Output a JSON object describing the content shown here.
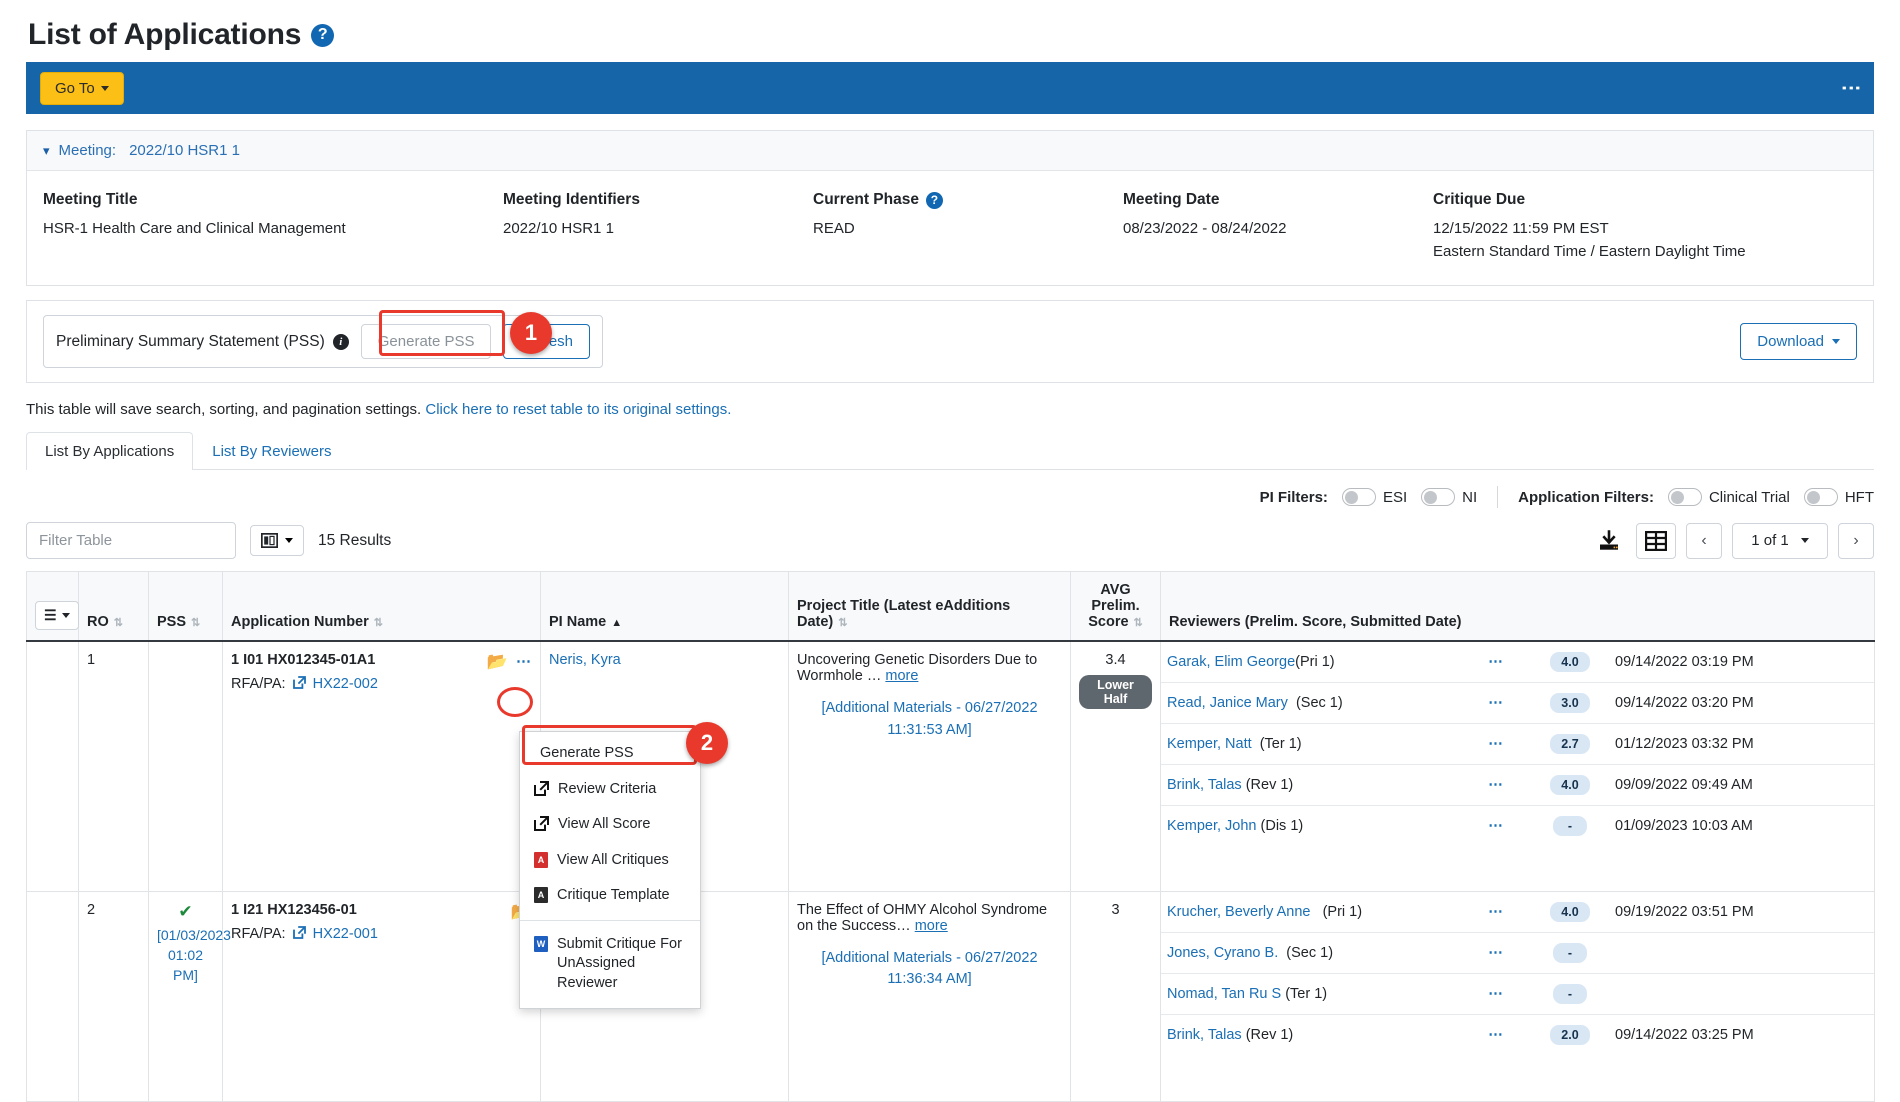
{
  "page": {
    "title": "List of Applications",
    "help_icon": "?"
  },
  "blue_bar": {
    "goto_label": "Go To",
    "kebab_icon": "⋮"
  },
  "meeting_panel": {
    "header_label": "Meeting:",
    "header_value": "2022/10 HSR1 1",
    "fields": [
      {
        "label": "Meeting Title",
        "value": "HSR-1 Health Care and Clinical Management",
        "help": false
      },
      {
        "label": "Meeting Identifiers",
        "value": "2022/10 HSR1 1",
        "help": false
      },
      {
        "label": "Current Phase",
        "value": "READ",
        "help": true
      },
      {
        "label": "Meeting Date",
        "value": "08/23/2022 - 08/24/2022",
        "help": false
      },
      {
        "label": "Critique Due",
        "value": "12/15/2022 11:59 PM EST",
        "value2": "Eastern Standard Time / Eastern Daylight Time",
        "help": false
      }
    ]
  },
  "pss_bar": {
    "label": "Preliminary Summary Statement (PSS)",
    "info_icon": "i",
    "generate_label": "Generate PSS",
    "refresh_label": "Refresh",
    "download_label": "Download"
  },
  "annotations": [
    {
      "number": "1"
    },
    {
      "number": "2"
    }
  ],
  "reset_note": {
    "text": "This table will save search, sorting, and pagination settings.",
    "link": "Click here to reset table to its original settings."
  },
  "tabs": [
    {
      "label": "List By Applications",
      "active": true
    },
    {
      "label": "List By Reviewers",
      "active": false
    }
  ],
  "filters": {
    "pi_label": "PI Filters:",
    "pi_items": [
      "ESI",
      "NI"
    ],
    "app_label": "Application Filters:",
    "app_items": [
      "Clinical Trial",
      "HFT"
    ]
  },
  "toolbar": {
    "filter_placeholder": "Filter Table",
    "results": "15 Results",
    "page_value": "1 of 1",
    "prev_icon": "‹",
    "next_icon": "›",
    "download_icon": "download-icon",
    "grid_icon": "grid-icon"
  },
  "table": {
    "columns": [
      {
        "key": "menu",
        "label": ""
      },
      {
        "key": "ro",
        "label": "RO",
        "sortable": true
      },
      {
        "key": "pss",
        "label": "PSS",
        "sortable": true
      },
      {
        "key": "appnum",
        "label": "Application Number",
        "sortable": true
      },
      {
        "key": "pi",
        "label": "PI Name",
        "sorted": "asc"
      },
      {
        "key": "proj",
        "label": "Project Title (Latest eAdditions Date)",
        "sortable": true
      },
      {
        "key": "avg",
        "label": "AVG Prelim. Score",
        "sortable": true
      },
      {
        "key": "rev",
        "label": "Reviewers (Prelim. Score, Submitted Date)"
      }
    ],
    "rows": [
      {
        "ro": "1",
        "pss_check": false,
        "pss_date": "",
        "app_number": "1 I01 HX012345-01A1",
        "rfa_label": "RFA/PA:",
        "rfa_value": "HX22-002",
        "pi_name": "Neris, Kyra",
        "project_title": "Uncovering Genetic Disorders Due to Wormhole …",
        "project_more": "more",
        "additional": "[Additional Materials - 06/27/2022 11:31:53 AM]",
        "avg_score": "3.4",
        "half_badge": "Lower Half",
        "reviewers": [
          {
            "name": "Garak, Elim George",
            "role": "(Pri 1)",
            "score": "4.0",
            "date": "09/14/2022 03:19 PM"
          },
          {
            "name": "Read, Janice Mary",
            "role": "(Sec 1)",
            "score": "3.0",
            "date": "09/14/2022 03:20 PM"
          },
          {
            "name": "Kemper, Natt",
            "role": "(Ter 1)",
            "score": "2.7",
            "date": "01/12/2023 03:32 PM"
          },
          {
            "name": "Brink, Talas",
            "role": "(Rev 1)",
            "score": "4.0",
            "date": "09/09/2022 09:49 AM"
          },
          {
            "name": "Kemper, John",
            "role": "(Dis 1)",
            "score": "-",
            "date": "01/09/2023 10:03 AM"
          }
        ]
      },
      {
        "ro": "2",
        "pss_check": true,
        "pss_date": "[01/03/2023 01:02 PM]",
        "app_number": "1 I21 HX123456-01",
        "rfa_label": "RFA/PA:",
        "rfa_value": "HX22-001",
        "pi_name": "",
        "project_title": "The Effect of OHMY Alcohol Syndrome on the Success…",
        "project_more": "more",
        "additional": "[Additional Materials - 06/27/2022 11:36:34 AM]",
        "avg_score": "3",
        "half_badge": "",
        "reviewers": [
          {
            "name": "Krucher, Beverly Anne",
            "role": "(Pri 1)",
            "score": "4.0",
            "date": "09/19/2022 03:51 PM"
          },
          {
            "name": "Jones, Cyrano B.",
            "role": "(Sec 1)",
            "score": "-",
            "date": ""
          },
          {
            "name": "Nomad, Tan Ru  S",
            "role": "(Ter 1)",
            "score": "-",
            "date": ""
          },
          {
            "name": "Brink, Talas",
            "role": "(Rev 1)",
            "score": "2.0",
            "date": "09/14/2022 03:25 PM"
          }
        ]
      }
    ]
  },
  "context_menu": {
    "items": [
      {
        "label": "Generate PSS",
        "icon": "none",
        "highlighted": true
      },
      {
        "label": "Review Criteria",
        "icon": "external-link"
      },
      {
        "label": "View All Score",
        "icon": "external-link"
      },
      {
        "label": "View All Critiques",
        "icon": "pdf"
      },
      {
        "label": "Critique Template",
        "icon": "pdf"
      },
      {
        "label": "Submit Critique For UnAssigned Reviewer",
        "icon": "word",
        "separator_before": true
      }
    ]
  },
  "colors": {
    "brand_blue": "#1565a8",
    "accent_yellow": "#fbbf16",
    "link_blue": "#1a6fb5",
    "annotation_red": "#e8392c",
    "success_green": "#1d8a3b"
  }
}
